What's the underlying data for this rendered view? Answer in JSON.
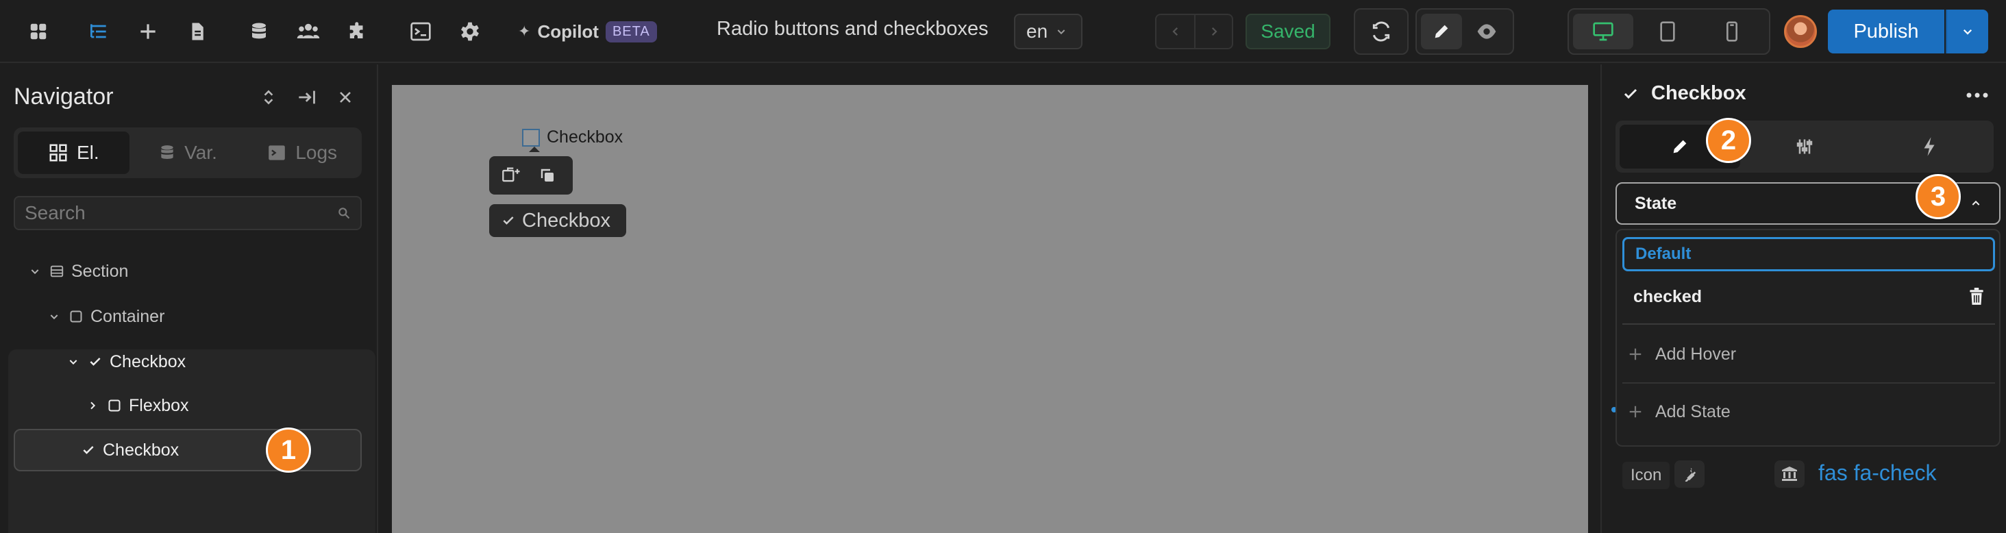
{
  "topbar": {
    "copilot_label": "Copilot",
    "beta_label": "BETA",
    "doc_title": "Radio buttons and checkboxes",
    "language": "en",
    "saved_label": "Saved",
    "publish_label": "Publish"
  },
  "navigator": {
    "title": "Navigator",
    "tabs": [
      {
        "label": "El.",
        "icon": "grid-icon"
      },
      {
        "label": "Var.",
        "icon": "database-icon"
      },
      {
        "label": "Logs",
        "icon": "terminal-icon"
      }
    ],
    "search_placeholder": "Search",
    "tree": [
      {
        "label": "Section",
        "icon": "section-icon"
      },
      {
        "label": "Container",
        "icon": "square-icon"
      },
      {
        "label": "Checkbox",
        "icon": "check-icon"
      },
      {
        "label": "Flexbox",
        "icon": "square-icon"
      },
      {
        "label": "Checkbox",
        "icon": "check-icon"
      }
    ]
  },
  "canvas": {
    "checkbox_label": "Checkbox",
    "element_tag": "Checkbox"
  },
  "panel": {
    "element_title": "Checkbox",
    "state_label": "State",
    "states": [
      {
        "label": "Default",
        "selected": true
      },
      {
        "label": "checked",
        "selected": false
      }
    ],
    "add_hover_label": "Add Hover",
    "add_state_label": "Add State",
    "icon_label": "Icon",
    "icon_value": "fas fa-check"
  },
  "badges": {
    "one": "1",
    "two": "2",
    "three": "3"
  },
  "colors": {
    "accent": "#2f8fd8",
    "publish": "#1b6fbf",
    "saved_green": "#35b46a",
    "badge_orange": "#f58220",
    "canvas_bg": "#8c8c8c"
  }
}
